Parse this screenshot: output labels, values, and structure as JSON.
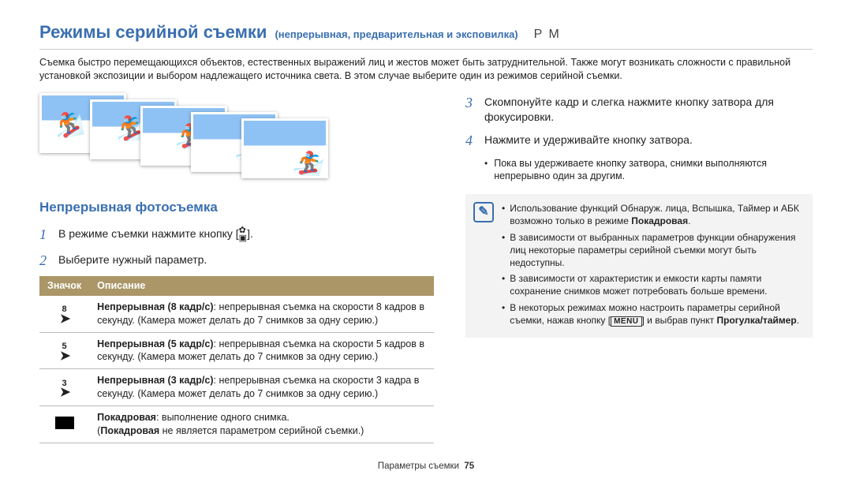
{
  "header": {
    "title": "Режимы серийной съемки",
    "subtitle": "(непрерывная, предварительная и эксповилка)",
    "pm": "P M"
  },
  "intro": "Съемка быстро перемещающихся объектов, естественных выражений лиц и жестов может быть затруднительной. Также могут возникать сложности с правильной установкой экспозиции и выбором надлежащего источника света. В этом случае выберите один из режимов серийной съемки.",
  "left": {
    "section": "Непрерывная фотосъемка",
    "step1": "В режиме съемки нажмите кнопку [",
    "step1_after": "].",
    "step2": "Выберите нужный параметр.",
    "table": {
      "h_icon": "Значок",
      "h_desc": "Описание",
      "rows": [
        {
          "num": "8",
          "title": "Непрерывная (8 кадр/с)",
          "body": ": непрерывная съемка на скорости 8 кадров в секунду. (Камера может делать до 7 снимков за одну серию.)"
        },
        {
          "num": "5",
          "title": "Непрерывная (5 кадр/с)",
          "body": ": непрерывная съемка на скорости 5 кадров в секунду. (Камера может делать до 7 снимков за одну серию.)"
        },
        {
          "num": "3",
          "title": "Непрерывная (3 кадр/с)",
          "body": ": непрерывная съемка на скорости 3 кадра в секунду. (Камера может делать до 7 снимков за одну серию.)"
        },
        {
          "num": "",
          "title": "Покадровая",
          "body_a": ": выполнение одного снимка.",
          "body_b_pre": "(",
          "body_b_bold": "Покадровая",
          "body_b_post": " не является параметром серийной съемки.)"
        }
      ]
    }
  },
  "right": {
    "step3": "Скомпонуйте кадр и слегка нажмите кнопку затвора для фокусировки.",
    "step4": "Нажмите и удерживайте кнопку затвора.",
    "bullet4": "Пока вы удерживаете кнопку затвора, снимки выполняются непрерывно один за другим.",
    "notes": {
      "n1_a": "Использование функций Обнаруж. лица, Вспышка, Таймер и АБК возможно только в режиме ",
      "n1_b": "Покадровая",
      "n1_c": ".",
      "n2": "В зависимости от выбранных параметров функции обнаружения лиц некоторые параметры серийной съемки могут быть недоступны.",
      "n3": "В зависимости от характеристик и емкости карты памяти сохранение снимков может потребовать больше времени.",
      "n4_a": "В некоторых режимах можно настроить параметры серийной съемки, нажав кнопку [",
      "n4_menu": "MENU",
      "n4_b": "] и выбрав пункт ",
      "n4_bold": "Прогулка/таймер",
      "n4_c": "."
    }
  },
  "footer": {
    "label": "Параметры съемки",
    "page": "75"
  }
}
